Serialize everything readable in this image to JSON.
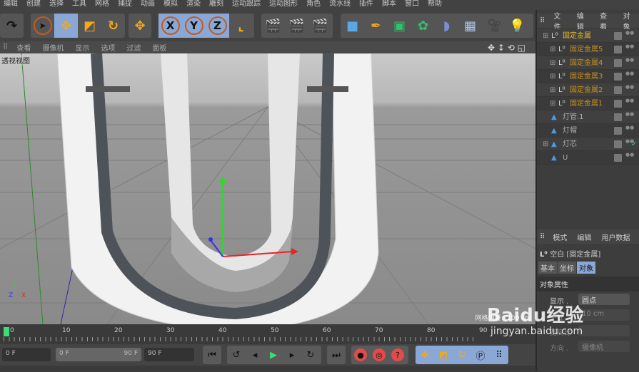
{
  "menu": [
    "编辑",
    "创建",
    "选择",
    "工具",
    "网格",
    "捕捉",
    "动画",
    "模拟",
    "渲染",
    "雕刻",
    "运动跟踪",
    "运动图形",
    "角色",
    "流水线",
    "插件",
    "脚本",
    "窗口",
    "帮助"
  ],
  "viewport_menu": [
    "查看",
    "摄像机",
    "显示",
    "选项",
    "过滤",
    "面板"
  ],
  "viewport": {
    "label": "透视视图",
    "grid_spacing": "网格间距 : 100 cm"
  },
  "timeline": {
    "ticks": [
      "0",
      "10",
      "20",
      "30",
      "40",
      "50",
      "60",
      "70",
      "80",
      "90"
    ],
    "current": "0"
  },
  "controls": {
    "current_frame": "0 F",
    "range_start": "0 F",
    "range_end": "90 F",
    "end_frame": "90 F"
  },
  "object_manager": {
    "menu": [
      "文件",
      "编辑",
      "查看",
      "对象"
    ],
    "items": [
      {
        "name": "固定金属",
        "color": "#e8b82a",
        "indent": 0,
        "expand": true
      },
      {
        "name": "固定金属5",
        "color": "#c8901a",
        "indent": 1,
        "expand": true
      },
      {
        "name": "固定金属4",
        "color": "#c8901a",
        "indent": 1,
        "expand": true
      },
      {
        "name": "固定金属3",
        "color": "#c8901a",
        "indent": 1,
        "expand": true
      },
      {
        "name": "固定金属2",
        "color": "#c8901a",
        "indent": 1,
        "expand": true
      },
      {
        "name": "固定金属1",
        "color": "#c8901a",
        "indent": 1,
        "expand": true
      },
      {
        "name": "灯管.1",
        "color": "#aaaaaa",
        "indent": 0,
        "expand": false
      },
      {
        "name": "灯帽",
        "color": "#aaaaaa",
        "indent": 0,
        "expand": false
      },
      {
        "name": "灯芯",
        "color": "#aaaaaa",
        "indent": 0,
        "expand": true,
        "check": "✓"
      },
      {
        "name": "U",
        "color": "#aaaaaa",
        "indent": 0,
        "expand": false
      }
    ]
  },
  "attributes": {
    "menu": [
      "模式",
      "编辑",
      "用户数据"
    ],
    "object_title": "空白 [固定金属]",
    "tabs": [
      "基本",
      "坐标",
      "对象"
    ],
    "section": "对象属性",
    "fields": [
      {
        "label": "显示 .",
        "value": "圆点"
      },
      {
        "label": "半径 .",
        "value": "10 cm"
      },
      {
        "label": "宽高比",
        "value": ""
      },
      {
        "label": "方向 .",
        "value": "摄像机"
      }
    ]
  },
  "watermark": {
    "brand": "Baidu经验",
    "url": "jingyan.baidu.com"
  }
}
